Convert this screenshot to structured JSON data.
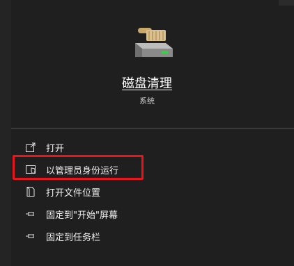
{
  "app": {
    "title": "磁盘清理",
    "subtitle": "系统",
    "icon": "disk-cleanup-icon"
  },
  "menu": {
    "items": [
      {
        "label": "打开",
        "icon": "open-icon"
      },
      {
        "label": "以管理员身份运行",
        "icon": "shield-admin-icon"
      },
      {
        "label": "打开文件位置",
        "icon": "file-location-icon"
      },
      {
        "label": "固定到\"开始\"屏幕",
        "icon": "pin-icon"
      },
      {
        "label": "固定到任务栏",
        "icon": "pin-icon"
      }
    ]
  },
  "colors": {
    "background": "#1f1f1f",
    "highlight": "#e8151b"
  }
}
